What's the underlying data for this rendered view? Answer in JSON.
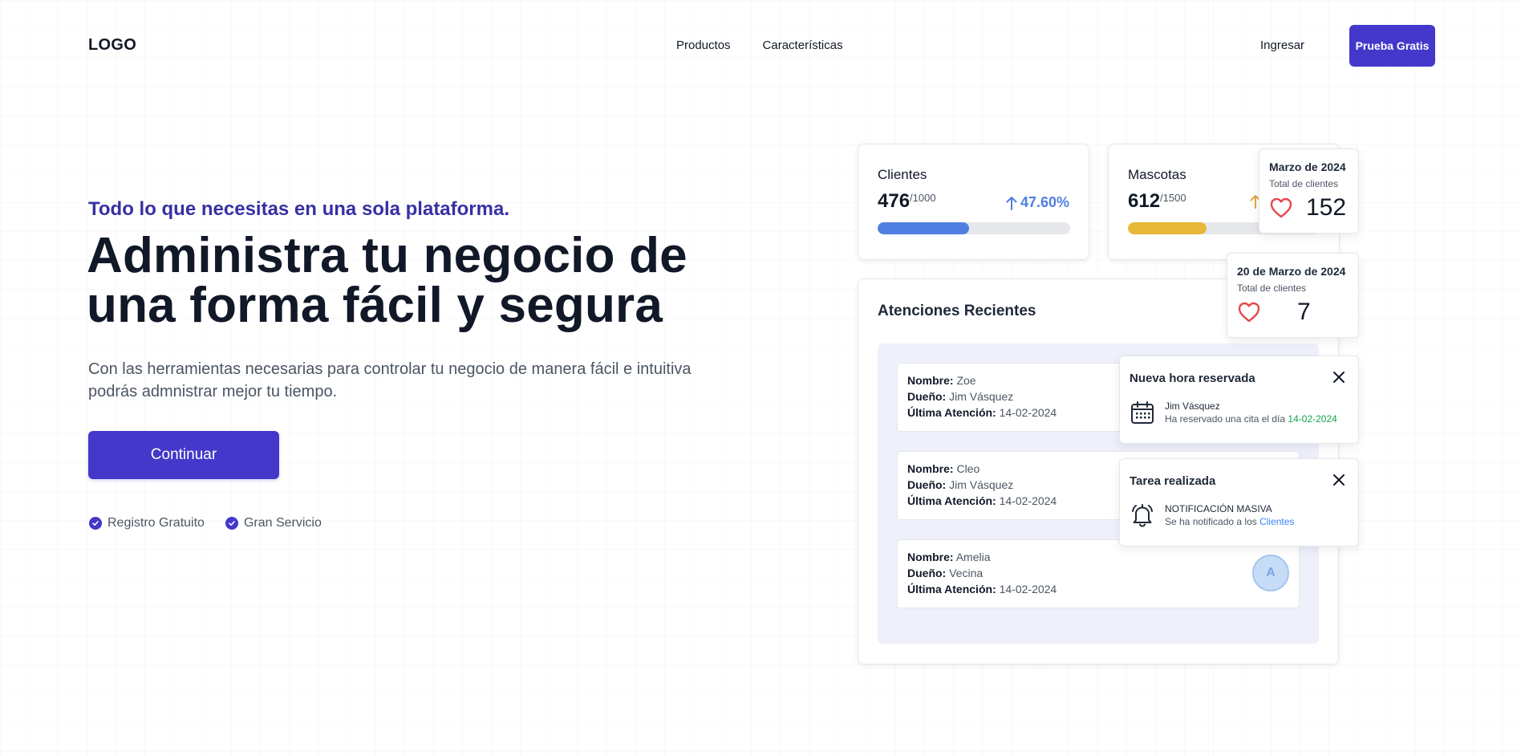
{
  "header": {
    "logo": "LOGO",
    "nav": [
      "Productos",
      "Características"
    ],
    "login": "Ingresar",
    "cta": "Prueba Gratis"
  },
  "hero": {
    "kicker": "Todo lo que necesitas en una sola plataforma.",
    "headline_line1": "Administra tu negocio de",
    "headline_line2": "una forma fácil y segura",
    "subtitle": "Con las herramientas necesarias para controlar tu negocio de manera fácil e intuitiva podrás admnistrar mejor tu tiempo.",
    "button": "Continuar",
    "perks": [
      "Registro Gratuito",
      "Gran Servicio"
    ]
  },
  "stats": {
    "clients": {
      "title": "Clientes",
      "value": "476",
      "total": "/1000",
      "growth": "47.60%",
      "progress": 0.476,
      "color": "#4f7fe0"
    },
    "pets": {
      "title": "Mascotas",
      "value": "612",
      "total": "/1500",
      "progress": 0.408,
      "color": "#e6b93a",
      "arrow_color": "#e6a33a"
    }
  },
  "mini_cards": {
    "month": {
      "title": "Marzo de 2024",
      "sub": "Total de clientes",
      "value": "152"
    },
    "day": {
      "title": "20 de Marzo de 2024",
      "sub": "Total de clientes",
      "value": "7"
    }
  },
  "recent": {
    "title": "Atenciones Recientes",
    "labels": {
      "name": "Nombre:",
      "owner": "Dueño:",
      "last": "Última Atención:"
    },
    "records": [
      {
        "name": "Zoe",
        "owner": "Jim Vásquez",
        "last": "14-02-2024"
      },
      {
        "name": "Cleo",
        "owner": "Jim Vásquez",
        "last": "14-02-2024"
      },
      {
        "name": "Amelia",
        "owner": "Vecina",
        "last": "14-02-2024",
        "avatar": "A"
      }
    ]
  },
  "notifications": [
    {
      "title": "Nueva hora reservada",
      "line1": "Jim Vásquez",
      "line2_prefix": "Ha reservado una cita el día ",
      "line2_highlight": "14-02-2024",
      "highlight_color": "#16a34a",
      "icon": "calendar-icon"
    },
    {
      "title": "Tarea realizada",
      "line1": "NOTIFICACIÓN MASIVA",
      "line2_prefix": "Se ha notificado a los ",
      "line2_highlight": "Clientes",
      "highlight_color": "#3b82f6",
      "icon": "bell-icon"
    }
  ],
  "colors": {
    "primary": "#4338ca",
    "heart": "#e5484d"
  }
}
